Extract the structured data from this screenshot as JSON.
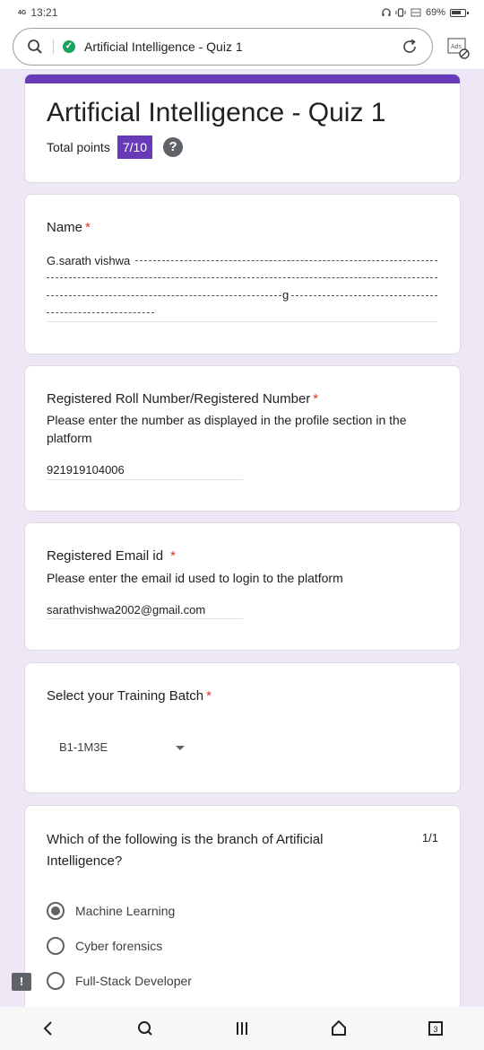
{
  "status_bar": {
    "network": "4G",
    "time": "13:21",
    "battery": "69%"
  },
  "browser": {
    "url_text": "Artificial Intelligence - Quiz 1",
    "ads_label": "Ads"
  },
  "form": {
    "title": "Artificial Intelligence - Quiz 1",
    "total_points_label": "Total points",
    "score": "7/10",
    "help_icon": "?"
  },
  "questions": {
    "name": {
      "label": "Name",
      "required": "*",
      "answer": "G.sarath vishwa",
      "scribble": "g"
    },
    "roll": {
      "label": "Registered Roll Number/Registered Number",
      "required": "*",
      "help_line1": "Please enter the number as displayed in the profile section in the",
      "help_line2": "platform",
      "answer": "921919104006"
    },
    "email": {
      "label": "Registered Email id",
      "required": "*",
      "help": "Please enter the email id used to login to the platform",
      "answer": "sarathvishwa2002@gmail.com"
    },
    "batch": {
      "label": "Select your Training Batch",
      "required": "*",
      "selected": "B1-1M3E"
    },
    "branch": {
      "label_line1": "Which of the following is the branch of Artificial",
      "label_line2": "Intelligence?",
      "points": "1/1",
      "options": [
        {
          "label": "Machine Learning",
          "checked": true
        },
        {
          "label": "Cyber forensics",
          "checked": false
        },
        {
          "label": "Full-Stack Developer",
          "checked": false
        }
      ]
    }
  },
  "feedback_icon": "!",
  "nav": {
    "tabs_count": "3"
  },
  "colors": {
    "accent": "#673ab7",
    "background": "#ede7f6",
    "required": "#d93025",
    "secure": "#1aa260"
  }
}
